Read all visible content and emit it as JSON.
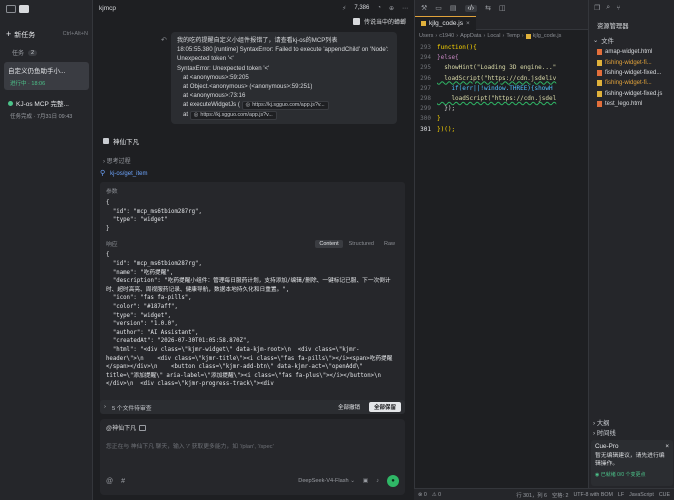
{
  "sidebar": {
    "new_task_label": "新任务",
    "new_task_shortcut": "Ctrl+Alt+N",
    "section_label": "任务",
    "task_count": "2",
    "tasks": [
      {
        "title": "自定义仍鱼助手小...",
        "status": "进行中 · 18:06"
      },
      {
        "title": "KJ-os MCP 完整...",
        "status": "任务完成 · 7月31日 09:43"
      }
    ]
  },
  "chat": {
    "header_title": "kjmcp",
    "header_count": "7,386",
    "user_name": "传说当中的蟑螂",
    "user_message": {
      "line1": "我的吃药提醒自定义小组件报错了，请查看kj-os的MCP列表",
      "line2": "18:05:55.380 [runtime] SyntaxError: Failed to execute 'appendChild' on 'Node':",
      "line3": "Unexpected token '<'",
      "line4": "SyntaxError: Unexpected token '<'",
      "line5": "at <anonymous>:59:205",
      "line6": "at Object.<anonymous> (<anonymous>:59:251)",
      "line7": "at <anonymous>:73:16",
      "line8_prefix": "at executeWidgetJs (",
      "link1": "https://kj.sgguo.com/app.js?v...",
      "line9_prefix": "at",
      "link2": "https://kj.sgguo.com/app.js?v..."
    },
    "agent_name": "神仙下凡",
    "thinking_label": "思考过程",
    "tool_name": "kj-os/get_item",
    "params_label": "参数",
    "params_code": "{\n  \"id\": \"mcp_ms6tbiom287rg\",\n  \"type\": \"widget\"\n}",
    "response_label": "响应",
    "response_tabs": {
      "content": "Content",
      "structured": "Structured",
      "raw": "Raw"
    },
    "response_code": "{\n  \"id\": \"mcp_ms6tbiom287rg\",\n  \"name\": \"吃药提醒\",\n  \"description\": \"吃药提醒小组件：管理每日服药计划，支持添加/编辑/删除、一键标记已服、下一次倒计\n时、超时高亮、周视服药记录、健康导航，数据本地持久化和日重置。\",\n  \"icon\": \"fas fa-pills\",\n  \"color\": \"#187aff\",\n  \"type\": \"widget\",\n  \"version\": \"1.0.0\",\n  \"author\": \"AI Assistant\",\n  \"createdAt\": \"2026-07-30T01:05:58.870Z\",\n  \"html\": \"<div class=\\\"kjmr-widget\\\" data-kjm-root>\\n  <div class=\\\"kjmr-\nheader\\\">\\n    <div class=\\\"kjmr-title\\\"><i class=\\\"fas fa-pills\\\"></i><span>吃药提醒\n</span></div>\\n    <button class=\\\"kjmr-add-btn\\\" data-kjmr-act=\\\"openAdd\\\"\ntitle=\\\"添加提醒\\\" aria-label=\\\"添加提醒\\\"><i class=\\\"fas fa-plus\\\"></i></button>\\n\n</div>\\n  <div class=\\\"kjmr-progress-track\\\"><div",
    "changes_label": "5 个文件待审查",
    "discard_all": "全部撤销",
    "keep_all": "全部保留",
    "mention_label": "@神仙下凡",
    "composer_placeholder": "您正在与 神仙下凡 聊天，输入 '/' 获取更多能力，如 '/plan', '/spec'",
    "model_name": "DeepSeek-V4-Flash"
  },
  "editor": {
    "tab_name": "kjlg_code.js",
    "breadcrumb": [
      "Users",
      "c1940",
      "AppData",
      "Local",
      "Temp",
      "kjlg_code.js"
    ],
    "lines": [
      {
        "n": "293",
        "t": "function(){"
      },
      {
        "n": "294",
        "t": "}else{"
      },
      {
        "n": "295",
        "t": "  showHint(\"Loading 3D engine...\""
      },
      {
        "n": "296",
        "t": "  loadScript(\"https://cdn.jsdeliv"
      },
      {
        "n": "297",
        "t": "    if(err||!window.THREE){showH"
      },
      {
        "n": "298",
        "t": "    loadScript(\"https://cdn.jsdel"
      },
      {
        "n": "299",
        "t": "  });"
      },
      {
        "n": "300",
        "t": "}"
      },
      {
        "n": "301",
        "t": "})();"
      }
    ]
  },
  "explorer": {
    "title": "资源管理器",
    "section": "文件",
    "files": [
      {
        "name": "amap-widget.html",
        "kind": "html",
        "modified": false
      },
      {
        "name": "fishing-widget-fi...",
        "kind": "js",
        "modified": true
      },
      {
        "name": "fishing-widget-fixed...",
        "kind": "html",
        "modified": false
      },
      {
        "name": "fishing-widget-fi...",
        "kind": "js",
        "modified": true
      },
      {
        "name": "fishing-widget-fixed.js",
        "kind": "js",
        "modified": false
      },
      {
        "name": "test_lego.html",
        "kind": "html",
        "modified": false
      }
    ],
    "outline": "大纲",
    "timeline": "时间线",
    "cue": {
      "title": "Cue-Pro",
      "body1": "暂无编辑建议，请先进行编",
      "body2": "辑操作。",
      "foot": "已就绪 0/0 个变更点"
    }
  },
  "statusbar": {
    "errors": "0",
    "warnings": "0",
    "position": "行 301，列 6",
    "spaces": "空格: 2",
    "encoding": "UTF-8 with BOM",
    "eol": "LF",
    "language": "JavaScript",
    "cue": "CUE"
  }
}
